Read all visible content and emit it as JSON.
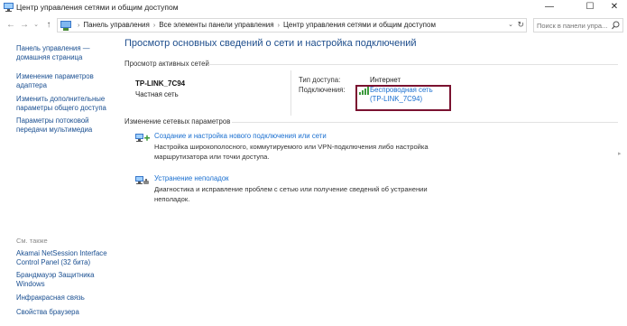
{
  "window": {
    "title": "Центр управления сетями и общим доступом",
    "minimize_glyph": "—",
    "maximize_glyph": "☐",
    "close_glyph": "✕"
  },
  "address": {
    "crumbs": [
      "Панель управления",
      "Все элементы панели управления",
      "Центр управления сетями и общим доступом"
    ],
    "search_placeholder": "Поиск в панели упра..."
  },
  "sidebar": {
    "links": [
      "Панель управления — домашняя страница",
      "Изменение параметров адаптера",
      "Изменить дополнительные параметры общего доступа",
      "Параметры потоковой передачи мультимедиа"
    ],
    "see_also_label": "См. также",
    "see_also": [
      "Akamai NetSession Interface Control Panel (32 бита)",
      "Брандмауэр Защитника Windows",
      "Инфракрасная связь",
      "Свойства браузера"
    ]
  },
  "main": {
    "title": "Просмотр основных сведений о сети и настройка подключений",
    "active_networks_label": "Просмотр активных сетей",
    "network": {
      "name": "TP-LINK_7C94",
      "type": "Частная сеть",
      "access_type_label": "Тип доступа:",
      "access_type_value": "Интернет",
      "connections_label": "Подключения:",
      "connection_link_line1": "Беспроводная сеть",
      "connection_link_line2": "(TP-LINK_7C94)"
    },
    "change_settings_label": "Изменение сетевых параметров",
    "tasks": [
      {
        "icon": "new-connection-icon",
        "link": "Создание и настройка нового подключения или сети",
        "desc": "Настройка широкополосного, коммутируемого или VPN-подключения либо настройка маршрутизатора или точки доступа."
      },
      {
        "icon": "troubleshoot-icon",
        "link": "Устранение неполадок",
        "desc": "Диагностика и исправление проблем с сетью или получение сведений об устранении неполадок."
      }
    ]
  },
  "colors": {
    "link": "#1a6fd0",
    "sidebar_link": "#1a4f91",
    "title": "#1d4d8c",
    "highlight_border": "#7a1230"
  }
}
